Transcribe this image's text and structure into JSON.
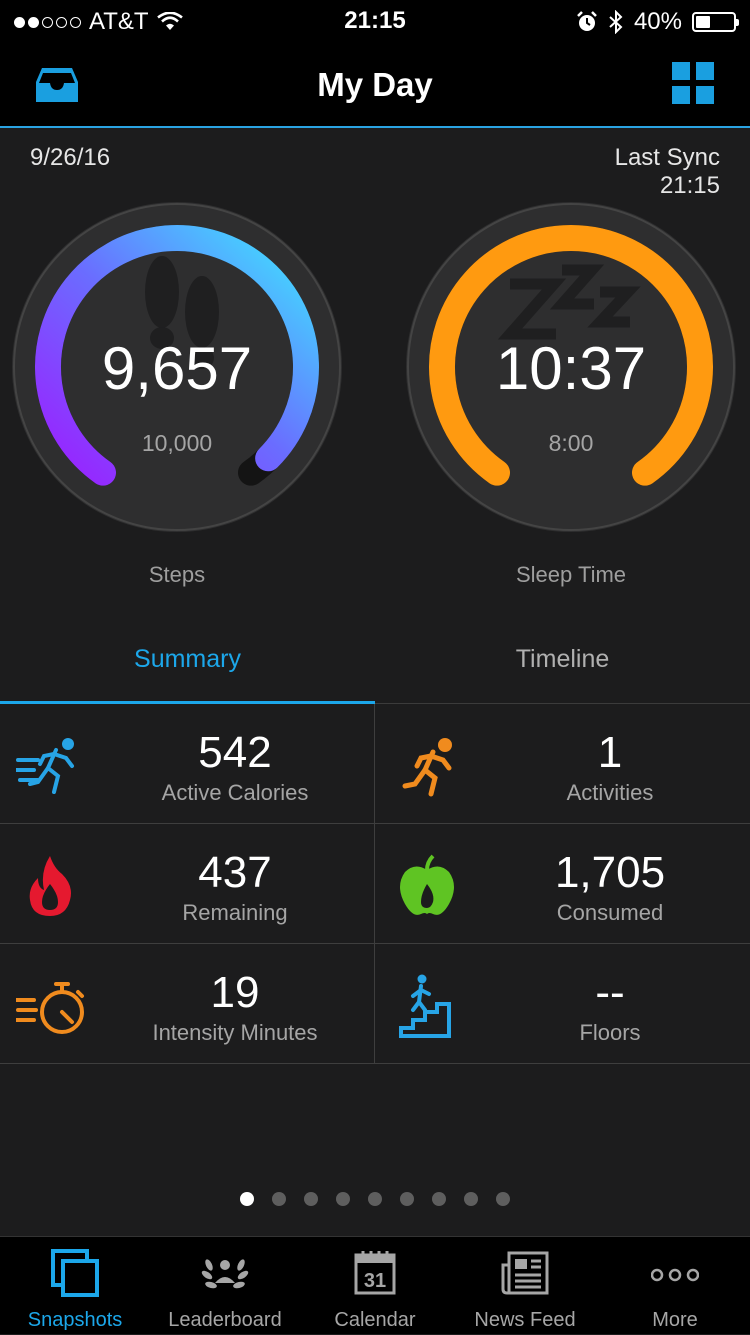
{
  "status_bar": {
    "carrier": "AT&T",
    "time": "21:15",
    "battery": "40%",
    "battery_level": 0.4
  },
  "header": {
    "title": "My Day",
    "left_icon": "inbox-icon",
    "right_icon": "grid-icon"
  },
  "date": "9/26/16",
  "sync": {
    "label": "Last Sync",
    "time": "21:15"
  },
  "rings": {
    "steps": {
      "value": "9,657",
      "goal": "10,000",
      "label": "Steps",
      "progress": 0.9657
    },
    "sleep": {
      "value": "10:37",
      "goal": "8:00",
      "label": "Sleep Time",
      "progress": 1.0
    }
  },
  "tabs": {
    "summary": "Summary",
    "timeline": "Timeline"
  },
  "stats": {
    "active_calories": {
      "value": "542",
      "label": "Active Calories"
    },
    "activities": {
      "value": "1",
      "label": "Activities"
    },
    "remaining": {
      "value": "437",
      "label": "Remaining"
    },
    "consumed": {
      "value": "1,705",
      "label": "Consumed"
    },
    "intensity": {
      "value": "19",
      "label": "Intensity Minutes"
    },
    "floors": {
      "value": "--",
      "label": "Floors"
    }
  },
  "pager": {
    "count": 9,
    "active": 0
  },
  "tabbar": {
    "snapshots": "Snapshots",
    "leaderboard": "Leaderboard",
    "calendar": "Calendar",
    "calendar_day": "31",
    "news_feed": "News Feed",
    "more": "More"
  },
  "colors": {
    "accent": "#1ca7ea",
    "sleep": "#ff9a10",
    "steps_start": "#9b1fff",
    "steps_end": "#3ee6ff"
  }
}
